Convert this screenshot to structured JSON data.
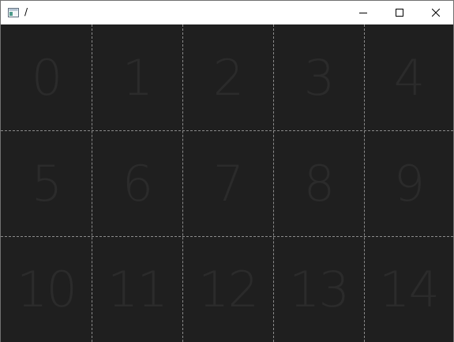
{
  "window": {
    "title": "/",
    "icon": "app-window-icon",
    "controls": {
      "minimize": "minimize-icon",
      "maximize": "maximize-icon",
      "close": "close-icon"
    }
  },
  "grid": {
    "columns": 5,
    "rows": 3,
    "cells": [
      "0",
      "1",
      "2",
      "3",
      "4",
      "5",
      "6",
      "7",
      "8",
      "9",
      "10",
      "11",
      "12",
      "13",
      "14"
    ]
  },
  "colors": {
    "background": "#1f1f1f",
    "grid_line": "#8a8a8a",
    "cell_text": "#2b2b2b",
    "titlebar": "#ffffff"
  }
}
